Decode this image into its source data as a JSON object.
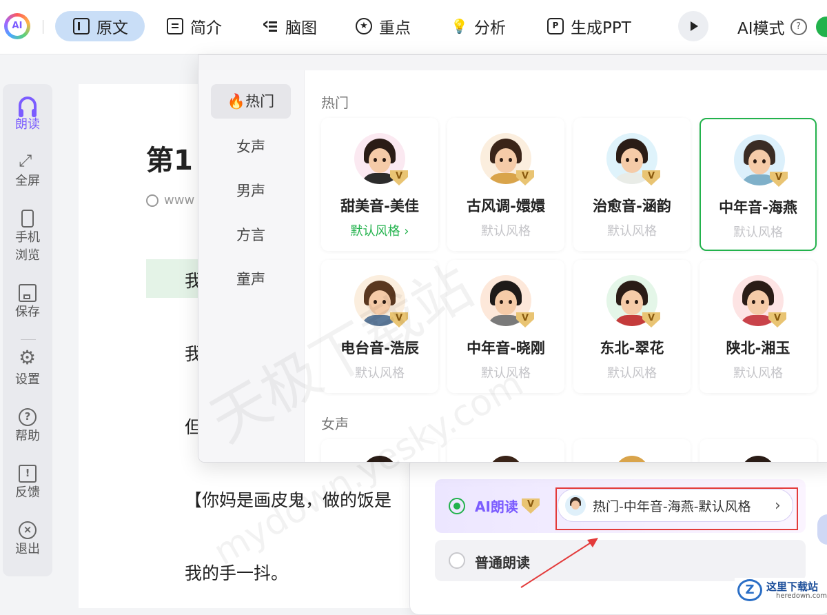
{
  "toolbar": {
    "logo_text": "AI",
    "tabs": [
      {
        "label": "原文",
        "icon": "document-icon",
        "active": true
      },
      {
        "label": "简介",
        "icon": "clipboard-icon",
        "active": false
      },
      {
        "label": "脑图",
        "icon": "mindmap-icon",
        "active": false
      },
      {
        "label": "重点",
        "icon": "star-circle-icon",
        "active": false
      },
      {
        "label": "分析",
        "icon": "lightbulb-icon",
        "active": false
      },
      {
        "label": "生成PPT",
        "icon": "ppt-icon",
        "active": false
      }
    ],
    "ai_mode_label": "AI模式",
    "help_glyph": "?",
    "ai_mode_on": true,
    "accent_color": "#22b24c"
  },
  "sidebar": {
    "items": [
      {
        "label": "朗读",
        "icon": "headphones-icon",
        "active": true
      },
      {
        "label": "全屏",
        "icon": "fullscreen-icon"
      },
      {
        "label": "手机",
        "label2": "浏览",
        "icon": "phone-icon"
      },
      {
        "label": "保存",
        "icon": "save-icon"
      },
      {
        "label": "设置",
        "icon": "gear-icon"
      },
      {
        "label": "帮助",
        "icon": "help-icon",
        "glyph": "?"
      },
      {
        "label": "反馈",
        "icon": "feedback-icon",
        "glyph": "!"
      },
      {
        "label": "退出",
        "icon": "exit-icon",
        "glyph": "×"
      }
    ]
  },
  "document": {
    "title": "第1",
    "url": "www",
    "paragraphs": [
      "我",
      "我",
      "但",
      "【你妈是画皮鬼，做的饭是",
      "我的手一抖。"
    ]
  },
  "voice_popup": {
    "categories": [
      {
        "label": "热门",
        "icon": "fire-icon",
        "active": true
      },
      {
        "label": "女声"
      },
      {
        "label": "男声"
      },
      {
        "label": "方言"
      },
      {
        "label": "童声"
      }
    ],
    "sections": [
      {
        "title": "热门",
        "voices": [
          {
            "name": "甜美音-美佳",
            "style": "默认风格 ›",
            "style_active": true,
            "selected": false,
            "hair": "#2a1c16",
            "body": "#2c2c2c",
            "bg": "#fbe9f1"
          },
          {
            "name": "古风调-嬛嬛",
            "style": "默认风格",
            "style_active": false,
            "selected": false,
            "hair": "#3a2418",
            "body": "#d9a44b",
            "bg": "#fbeede"
          },
          {
            "name": "治愈音-涵韵",
            "style": "默认风格",
            "style_active": false,
            "selected": false,
            "hair": "#2a1c16",
            "body": "#e9ece7",
            "bg": "#dff3fb"
          },
          {
            "name": "中年音-海燕",
            "style": "默认风格",
            "style_active": false,
            "selected": true,
            "hair": "#3a2c24",
            "body": "#7fb0c9",
            "bg": "#dcf0fb"
          },
          {
            "name": "电台音-浩辰",
            "style": "默认风格",
            "style_active": false,
            "selected": false,
            "hair": "#5a3820",
            "body": "#5d7a9a",
            "bg": "#fbeede"
          },
          {
            "name": "中年音-晓刚",
            "style": "默认风格",
            "style_active": false,
            "selected": false,
            "hair": "#1e1a18",
            "body": "#7a7a7a",
            "bg": "#fde8da"
          },
          {
            "name": "东北-翠花",
            "style": "默认风格",
            "style_active": false,
            "selected": false,
            "hair": "#2a1c16",
            "body": "#c43b3b",
            "bg": "#e4f6e8"
          },
          {
            "name": "陕北-湘玉",
            "style": "默认风格",
            "style_active": false,
            "selected": false,
            "hair": "#2a1c16",
            "body": "#c9434a",
            "bg": "#fde4e4"
          }
        ]
      },
      {
        "title": "女声"
      }
    ]
  },
  "reading_panel": {
    "ai_reading_label": "AI朗读",
    "ai_reading_selected": true,
    "current_voice": "热门-中年音-海燕-默认风格",
    "arrow_glyph": "›",
    "normal_reading_label": "普通朗读",
    "normal_reading_selected": false
  },
  "watermark": {
    "text": "天极下载站",
    "subtext": "mydown.yesky.com"
  },
  "site_logo": {
    "glyph": "Z",
    "title": "这里下载站",
    "domain": "heredown.com"
  }
}
